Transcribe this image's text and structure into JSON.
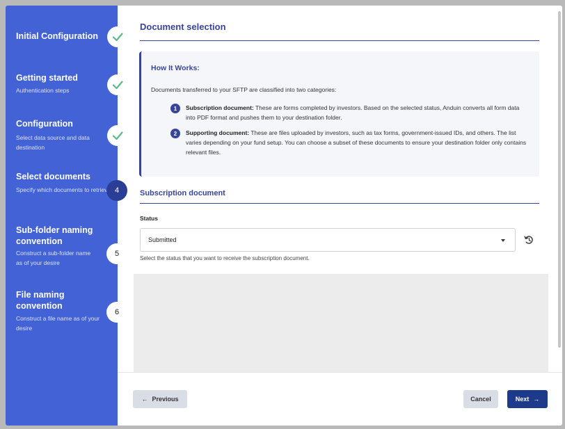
{
  "sidebar": {
    "steps": [
      {
        "title": "Initial Configuration",
        "desc": "",
        "status": "done",
        "badge": ""
      },
      {
        "title": "Getting started",
        "desc": "Authentication steps",
        "status": "done",
        "badge": ""
      },
      {
        "title": "Configuration",
        "desc": "Select data source and data destination",
        "status": "done",
        "badge": ""
      },
      {
        "title": "Select documents",
        "desc": "Specify which documents to retrieve",
        "status": "active",
        "badge": "4"
      },
      {
        "title": "Sub-folder naming convention",
        "desc": "Construct a sub-folder name as of your desire",
        "status": "todo",
        "badge": "5"
      },
      {
        "title": "File naming convention",
        "desc": "Construct a file name as of your desire",
        "status": "todo",
        "badge": "6"
      }
    ]
  },
  "main": {
    "title": "Document selection",
    "info": {
      "title": "How It Works:",
      "intro": "Documents transferred to your SFTP are classified into two categories:",
      "items": [
        {
          "num": "1",
          "bold": "Subscription document:",
          "text": " These are forms completed by investors. Based on the selected status, Anduin converts all form data into PDF format and pushes them to your destination folder."
        },
        {
          "num": "2",
          "bold": "Supporting document:",
          "text": " These are files uploaded by investors, such as tax forms, government-issued IDs, and others. The list varies depending on your fund setup. You can choose a subset of these documents to ensure your destination folder only contains relevant files."
        }
      ]
    },
    "section_title": "Subscription document",
    "status_label": "Status",
    "status_value": "Submitted",
    "helper": "Select the status that you want to receive the subscription document."
  },
  "footer": {
    "previous": "Previous",
    "cancel": "Cancel",
    "next": "Next"
  },
  "colors": {
    "sidebar": "#4262d6",
    "accent": "#37449a",
    "check": "#5cb98a",
    "next_button": "#1e3a8a"
  }
}
